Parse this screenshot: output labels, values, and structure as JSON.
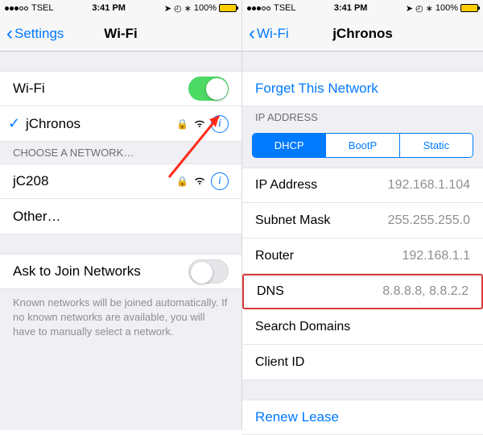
{
  "status": {
    "carrier": "TSEL",
    "time": "3:41 PM",
    "battery": "100%"
  },
  "left": {
    "back": "Settings",
    "title": "Wi-Fi",
    "wifi_label": "Wi-Fi",
    "connected": "jChronos",
    "choose_header": "Choose a Network…",
    "networks": [
      "jC208",
      "Other…"
    ],
    "ask_label": "Ask to Join Networks",
    "ask_footer": "Known networks will be joined automatically. If no known networks are available, you will have to manually select a network."
  },
  "right": {
    "back": "Wi-Fi",
    "title": "jChronos",
    "forget": "Forget This Network",
    "ip_header": "IP Address",
    "tabs": [
      "DHCP",
      "BootP",
      "Static"
    ],
    "fields": [
      {
        "k": "IP Address",
        "v": "192.168.1.104"
      },
      {
        "k": "Subnet Mask",
        "v": "255.255.255.0"
      },
      {
        "k": "Router",
        "v": "192.168.1.1"
      },
      {
        "k": "DNS",
        "v": "8.8.8.8, 8.8.2.2"
      },
      {
        "k": "Search Domains",
        "v": ""
      },
      {
        "k": "Client ID",
        "v": ""
      }
    ],
    "renew": "Renew Lease"
  }
}
